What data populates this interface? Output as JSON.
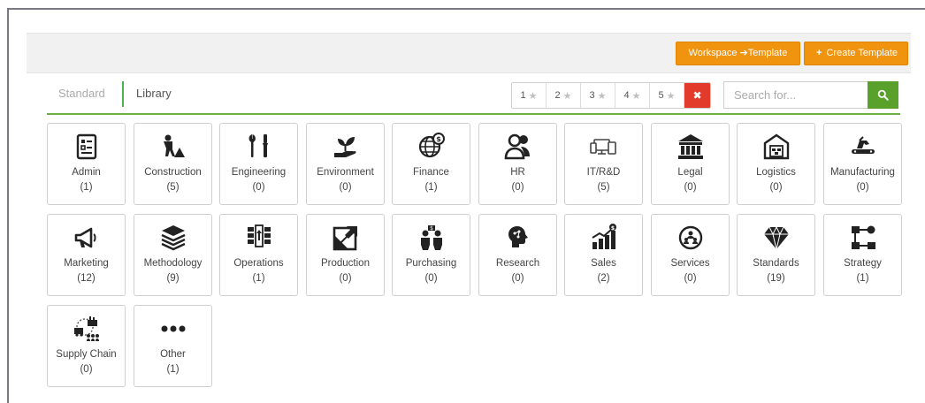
{
  "toolbar": {
    "workspace_template_label": "Workspace ➔Template",
    "create_template_label": "Create Template",
    "create_template_icon": "+"
  },
  "tabs": {
    "standard": "Standard",
    "library": "Library"
  },
  "rating_filter": {
    "levels": [
      "1",
      "2",
      "3",
      "4",
      "5"
    ],
    "star_glyph": "★",
    "clear_glyph": "✖"
  },
  "search": {
    "placeholder": "Search for..."
  },
  "categories": [
    {
      "icon": "admin-icon",
      "label": "Admin",
      "count": "(1)"
    },
    {
      "icon": "construction-icon",
      "label": "Construction",
      "count": "(5)"
    },
    {
      "icon": "engineering-icon",
      "label": "Engineering",
      "count": "(0)"
    },
    {
      "icon": "environment-icon",
      "label": "Environment",
      "count": "(0)"
    },
    {
      "icon": "finance-icon",
      "label": "Finance",
      "count": "(1)"
    },
    {
      "icon": "hr-icon",
      "label": "HR",
      "count": "(0)"
    },
    {
      "icon": "it-rd-icon",
      "label": "IT/R&D",
      "count": "(5)"
    },
    {
      "icon": "legal-icon",
      "label": "Legal",
      "count": "(0)"
    },
    {
      "icon": "logistics-icon",
      "label": "Logistics",
      "count": "(0)"
    },
    {
      "icon": "manufacturing-icon",
      "label": "Manufacturing",
      "count": "(0)"
    },
    {
      "icon": "marketing-icon",
      "label": "Marketing",
      "count": "(12)"
    },
    {
      "icon": "methodology-icon",
      "label": "Methodology",
      "count": "(9)"
    },
    {
      "icon": "operations-icon",
      "label": "Operations",
      "count": "(1)"
    },
    {
      "icon": "production-icon",
      "label": "Production",
      "count": "(0)"
    },
    {
      "icon": "purchasing-icon",
      "label": "Purchasing",
      "count": "(0)"
    },
    {
      "icon": "research-icon",
      "label": "Research",
      "count": "(0)"
    },
    {
      "icon": "sales-icon",
      "label": "Sales",
      "count": "(2)"
    },
    {
      "icon": "services-icon",
      "label": "Services",
      "count": "(0)"
    },
    {
      "icon": "standards-icon",
      "label": "Standards",
      "count": "(19)"
    },
    {
      "icon": "strategy-icon",
      "label": "Strategy",
      "count": "(1)"
    },
    {
      "icon": "supply-chain-icon",
      "label": "Supply Chain",
      "count": "(0)"
    },
    {
      "icon": "other-icon",
      "label": "Other",
      "count": "(1)"
    }
  ],
  "colors": {
    "accent_orange": "#f0930f",
    "accent_green": "#6cb043",
    "search_button_green": "#5aa12b",
    "clear_red": "#e33b2b"
  }
}
